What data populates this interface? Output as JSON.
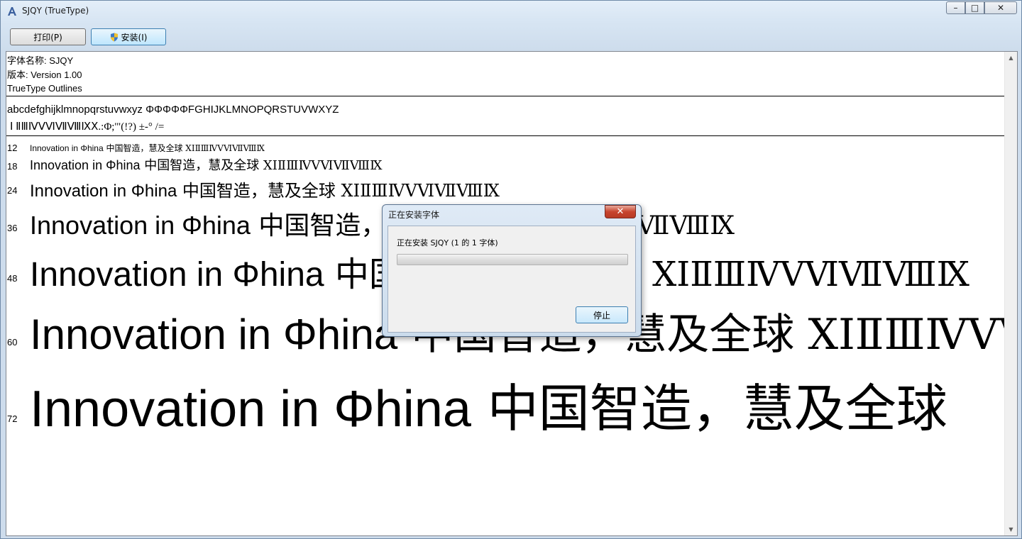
{
  "window": {
    "title": "SJQY (TrueType)",
    "min_glyph": "–",
    "max_glyph": "□",
    "close_glyph": "✕"
  },
  "toolbar": {
    "print_label": "打印(P)",
    "install_label": "安装(I)"
  },
  "font_info": {
    "name": "字体名称: SJQY",
    "version": "版本: Version 1.00",
    "outline": "TrueType Outlines"
  },
  "charset": {
    "line1": "abcdefghijklmnopqrstuvwxyz ΦΦΦΦΦFGHIJKLMNOPQRSTUVWXYZ",
    "line2": "Ⅰ ⅡⅢⅣⅤⅥⅦⅧⅨⅩ.:Φ;'\"(!?) ±-° /="
  },
  "samples": [
    {
      "size": "12",
      "text": "Innovation in Φhina",
      "cjk": " 中国智造，慧及全球 ⅩⅠⅡⅢⅣⅤⅥⅦⅧⅨ"
    },
    {
      "size": "18",
      "text": "Innovation in Φhina",
      "cjk": " 中国智造，慧及全球 ⅩⅠⅡⅢⅣⅤⅥⅦⅧⅨ"
    },
    {
      "size": "24",
      "text": "Innovation in Φhina",
      "cjk": " 中国智造，慧及全球 ⅩⅠⅡⅢⅣⅤⅥⅦⅧⅨ"
    },
    {
      "size": "36",
      "text": "Innovation in Φhina",
      "cjk": " 中国智造，慧及全球 ⅩⅠⅡⅢⅣⅤⅥⅦⅧⅨ"
    },
    {
      "size": "48",
      "text": "Innovation in Φhina",
      "cjk": " 中国智造，慧及全球 ⅩⅠⅡⅢⅣⅤⅥⅦⅧⅨ"
    },
    {
      "size": "60",
      "text": "Innovation in Φhina",
      "cjk": " 中国智造，慧及全球 ⅩⅠⅡⅢⅣⅤⅥⅦⅧⅨ"
    },
    {
      "size": "72",
      "text": "Innovation in Φhina",
      "cjk": " 中国智造，慧及全球"
    }
  ],
  "dialog": {
    "title": "正在安装字体",
    "message": "正在安装 SJQY (1 的 1 字体)",
    "progress": 0.0,
    "stop_label": "停止",
    "close_glyph": "✕"
  },
  "scrollbar": {
    "up_glyph": "▲",
    "down_glyph": "▼"
  }
}
